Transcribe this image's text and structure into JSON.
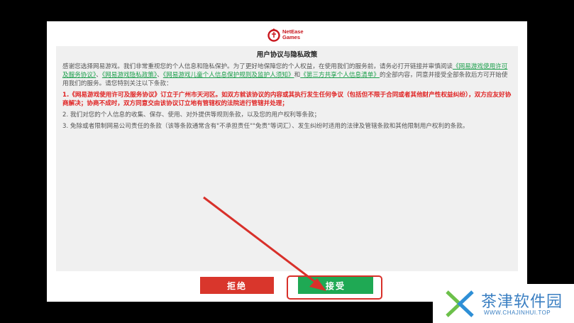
{
  "logo": {
    "line1": "NetEase",
    "line2": "Games"
  },
  "dialog": {
    "title": "用户协议与隐私政策",
    "intro_text_1": "感谢您选择网易游戏。我们非常重视您的个人信息和隐私保护。为了更好地保障您的个人权益，在使用我们的服务前，请务必打开链接并审慎阅读",
    "links": [
      "《网易游戏使用许可及服务协议》",
      "《网易游戏隐私政策》",
      "《网易游戏儿童个人信息保护规则及监护人须知》",
      "《第三方共享个人信息清单》"
    ],
    "sep1": "、",
    "sep2": "、",
    "sep3": "和",
    "intro_text_2": "的全部内容，同意并接受全部条款后方可开始使用我们的服务。请您特别关注以下条款：",
    "clause1": "1.《网易游戏使用许可及服务协议》订立于广州市天河区。如双方就该协议的内容或其执行发生任何争议（包括但不限于合同或者其他财产性权益纠纷），双方应友好协商解决；协商不成时，双方同意交由该协议订立地有管辖权的法院进行管辖并处理；",
    "clause2": "2. 我们对您的个人信息的收集、保存、使用、对外提供等规则条款，以及您的用户权利等条款；",
    "clause3": "3. 免除或者限制网易公司责任的条款（该等条款通常含有\"不承担责任\"\"免责\"等词汇）、发生纠纷时适用的法律及管辖条款和其他限制用户权利的条款。"
  },
  "buttons": {
    "reject": "拒绝",
    "accept": "接受"
  },
  "watermark": {
    "name": "茶津软件园",
    "url": "WWW.CHAJINHUI.TOP"
  },
  "colors": {
    "reject": "#d9362c",
    "accept": "#1fa954",
    "link": "#1a9e4a",
    "warning": "#e02323",
    "annotation": "#d8302a"
  }
}
